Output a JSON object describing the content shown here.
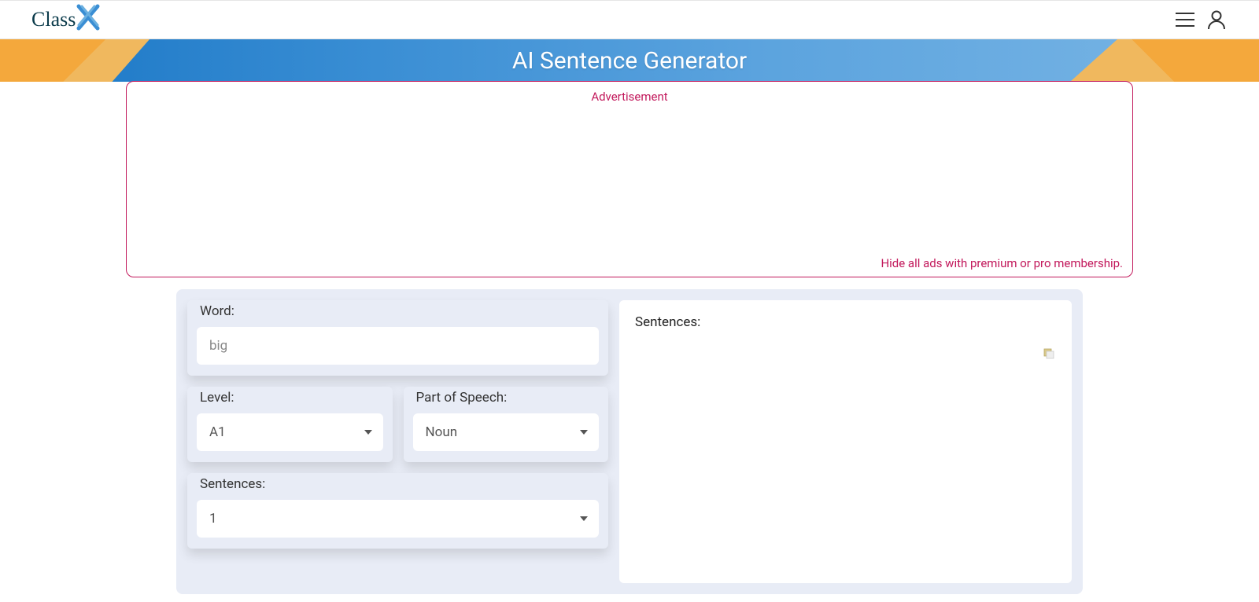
{
  "logo": {
    "text": "Class"
  },
  "banner": {
    "title": "AI Sentence Generator"
  },
  "ad": {
    "label": "Advertisement",
    "hide_text": "Hide all ads with premium or pro membership."
  },
  "form": {
    "word": {
      "label": "Word:",
      "placeholder": "big",
      "value": ""
    },
    "level": {
      "label": "Level:",
      "value": "A1",
      "options": [
        "A1"
      ]
    },
    "pos": {
      "label": "Part of Speech:",
      "value": "Noun",
      "options": [
        "Noun"
      ]
    },
    "sentences_count": {
      "label": "Sentences:",
      "value": "1",
      "options": [
        "1"
      ]
    }
  },
  "output": {
    "title": "Sentences:"
  }
}
